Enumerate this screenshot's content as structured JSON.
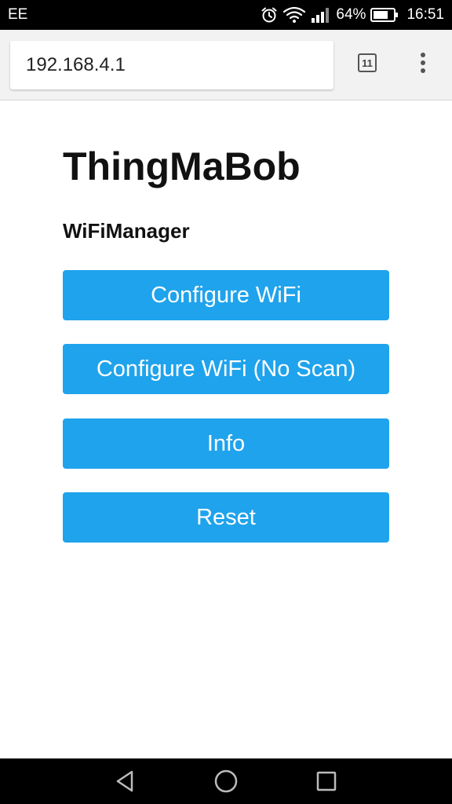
{
  "status_bar": {
    "carrier": "EE",
    "battery_percent": "64%",
    "time": "16:51",
    "icons": [
      "alarm-icon",
      "wifi-icon",
      "signal-icon",
      "battery-icon"
    ]
  },
  "browser": {
    "url": "192.168.4.1",
    "tab_count": "11",
    "icons": [
      "tab-switcher-icon",
      "overflow-menu-icon"
    ]
  },
  "page": {
    "title": "ThingMaBob",
    "subtitle": "WiFiManager",
    "buttons": [
      {
        "label": "Configure WiFi"
      },
      {
        "label": "Configure WiFi (No Scan)"
      },
      {
        "label": "Info"
      },
      {
        "label": "Reset"
      }
    ]
  },
  "nav_bar": {
    "icons": [
      "back-icon",
      "home-icon",
      "recents-icon"
    ]
  },
  "colors": {
    "button_bg": "#1fa3ec",
    "button_text": "#ffffff",
    "status_bar_bg": "#000000",
    "toolbar_bg": "#f2f2f2"
  }
}
